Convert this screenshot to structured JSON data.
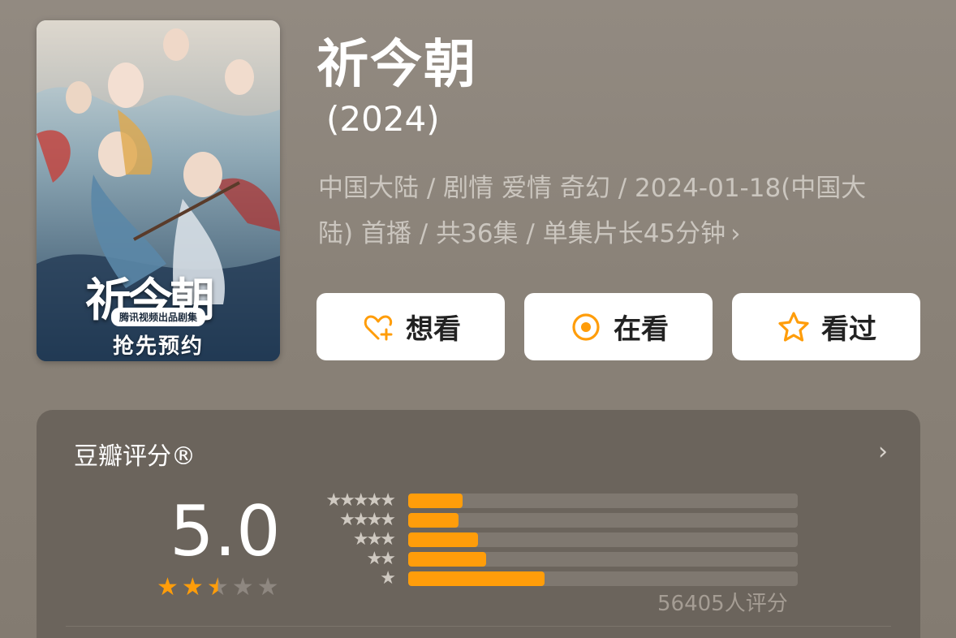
{
  "poster": {
    "title_art": "祈今朝",
    "badge": "腾讯视频出品剧集",
    "promo": "抢先预约"
  },
  "movie": {
    "title": "祈今朝",
    "year": "(2024)",
    "meta_line1": "中国大陆 / 剧情 爱情 奇幻 / 2024-01-18(中国大",
    "meta_line2": "陆) 首播 / 共36集 / 单集片长45分钟",
    "meta_chevron": "›"
  },
  "actions": [
    {
      "label": "想看",
      "icon": "heart-plus-icon"
    },
    {
      "label": "在看",
      "icon": "target-circle-icon"
    },
    {
      "label": "看过",
      "icon": "star-outline-icon"
    }
  ],
  "rating": {
    "header": "豆瓣评分®",
    "chevron": "›",
    "score": "5.0",
    "stars_display": 2.5,
    "count": "56405人评分",
    "distribution": [
      {
        "stars": "★★★★★",
        "percent": 14
      },
      {
        "stars": "★★★★",
        "percent": 13
      },
      {
        "stars": "★★★",
        "percent": 18
      },
      {
        "stars": "★★",
        "percent": 20
      },
      {
        "stars": "★",
        "percent": 35
      }
    ]
  },
  "colors": {
    "accent": "#ff9d0a",
    "card_bg": "#6b645c",
    "page_bg": "#8a8278"
  }
}
